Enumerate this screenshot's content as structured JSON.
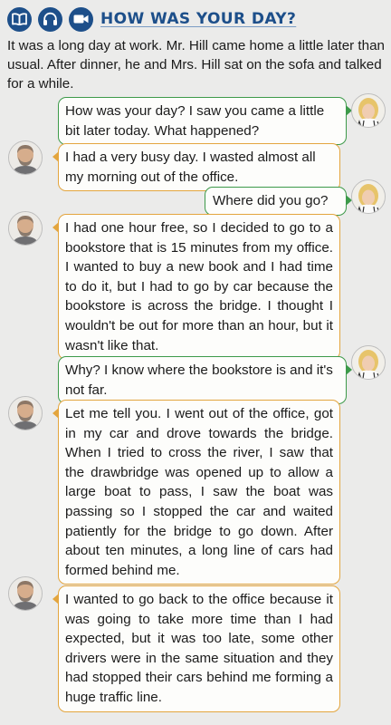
{
  "header": {
    "title": "HOW WAS YOUR DAY?",
    "icons": [
      "book-icon",
      "headphones-icon",
      "video-camera-icon"
    ],
    "icon_color": "#1d4f8a"
  },
  "intro": "It was a long day at work. Mr. Hill came home a little later than usual. After dinner, he and Mrs. Hill sat on the sofa and talked for a while.",
  "colors": {
    "woman_border": "#3d9a4a",
    "man_border": "#e3a53e",
    "background": "#ebebea"
  },
  "dialogue": [
    {
      "speaker": "woman",
      "text": "How was your day? I saw you came a little bit later today. What happened?"
    },
    {
      "speaker": "man",
      "text": "I had a very busy day. I wasted almost all my morning out of the office."
    },
    {
      "speaker": "woman",
      "text": "Where did you go?"
    },
    {
      "speaker": "man",
      "text": "I had one hour free, so I decided to go to a bookstore that is 15 minutes from my office. I wanted to buy a new book and I had time to do it, but I had to go by car because the bookstore is across the bridge. I thought I wouldn't be out for more than an hour, but it wasn't like that."
    },
    {
      "speaker": "woman",
      "text": "Why? I know where the bookstore is and it's not far."
    },
    {
      "speaker": "man",
      "text": "Let me tell you. I went out of the office, got in my car and drove towards the bridge. When I tried to cross the river, I saw that the drawbridge was opened up to allow a large boat to pass, I saw the boat was passing so I stopped the car and waited patiently for the bridge to go down. After about ten minutes, a long line of cars had formed behind me."
    },
    {
      "speaker": "man",
      "text": "I wanted to go back to the office because it was going to take more time than I had expected, but it was too late, some other drivers were in the same situation and they had stopped their cars behind me forming a huge traffic line."
    }
  ]
}
